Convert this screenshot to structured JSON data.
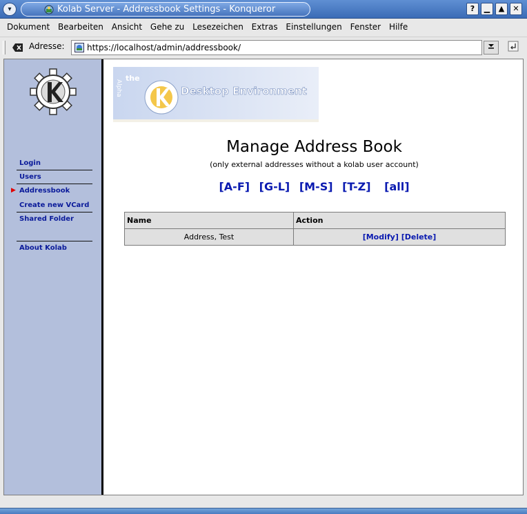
{
  "window": {
    "title": "Kolab Server - Addressbook Settings - Konqueror",
    "menu_button": "▾",
    "help_button": "?",
    "minimize_button": "▁",
    "maximize_button": "▲",
    "close_button": "✕"
  },
  "menubar": {
    "items": [
      "Dokument",
      "Bearbeiten",
      "Ansicht",
      "Gehe zu",
      "Lesezeichen",
      "Extras",
      "Einstellungen",
      "Fenster",
      "Hilfe"
    ]
  },
  "location": {
    "label": "Adresse:",
    "url": "https://localhost/admin/addressbook/"
  },
  "sidebar": {
    "items": [
      {
        "label": "Login"
      },
      {
        "label": "Users"
      },
      {
        "label": "Addressbook"
      },
      {
        "label": "Create new VCard"
      },
      {
        "label": "Shared Folder"
      },
      {
        "label": "About Kolab"
      }
    ],
    "active_index": 2
  },
  "banner": {
    "small_text": "the",
    "side_text": "Alpha",
    "main_text": "Desktop Environment"
  },
  "main": {
    "title": "Manage Address Book",
    "subtitle": "(only external addresses without a kolab user account)",
    "letter_filters": [
      "[A-F]",
      "[G-L]",
      "[M-S]",
      "[T-Z]",
      "[all]"
    ],
    "table": {
      "headers": [
        "Name",
        "Action"
      ],
      "rows": [
        {
          "name": "Address, Test",
          "modify": "[Modify]",
          "delete": "[Delete]"
        }
      ]
    }
  },
  "colors": {
    "sidebar_bg": "#b3bfdc",
    "link": "#0a1ab0",
    "titlebar": "#4774bd"
  }
}
